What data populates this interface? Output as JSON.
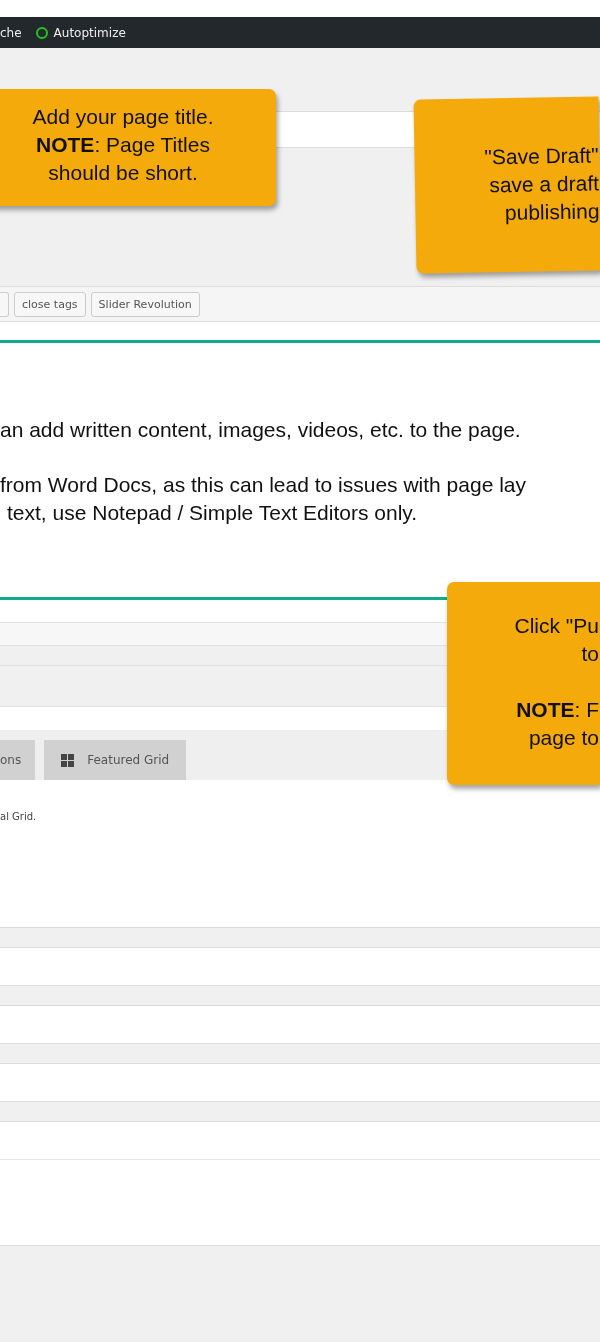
{
  "admin_bar": {
    "items": [
      {
        "kind": "plain",
        "label": "che"
      },
      {
        "kind": "status",
        "label": "Autoptimize"
      }
    ]
  },
  "editor_toolbar": {
    "buttons": [
      "close tags",
      "Slider Revolution"
    ]
  },
  "editor": {
    "paragraphs": [
      [
        {
          "text": "an add written content, images, videos, etc. to the page.",
          "indent": false
        }
      ],
      [
        {
          "text": "from Word Docs, as this can lead to issues with page lay",
          "indent": false
        },
        {
          "text": "text, use Notepad / Simple Text Editors only.",
          "indent": true
        }
      ]
    ]
  },
  "grid_tabs": [
    {
      "label": "ons",
      "icon": false
    },
    {
      "label": "Featured Grid",
      "icon": true
    }
  ],
  "grid_note": "al Grid.",
  "callouts": [
    {
      "kind": "left",
      "paragraphs": [
        [
          "Add your page title.",
          "**NOTE**: Page Titles",
          "should be short."
        ]
      ]
    },
    {
      "kind": "right-top",
      "paragraphs": [
        [
          "\"Save Draft\"",
          "save a draft",
          "publishing"
        ]
      ]
    },
    {
      "kind": "right-bottom",
      "paragraphs": [
        [
          "Click \"Pu",
          "to"
        ],
        [
          "**NOTE**: F",
          "page to"
        ]
      ]
    }
  ]
}
